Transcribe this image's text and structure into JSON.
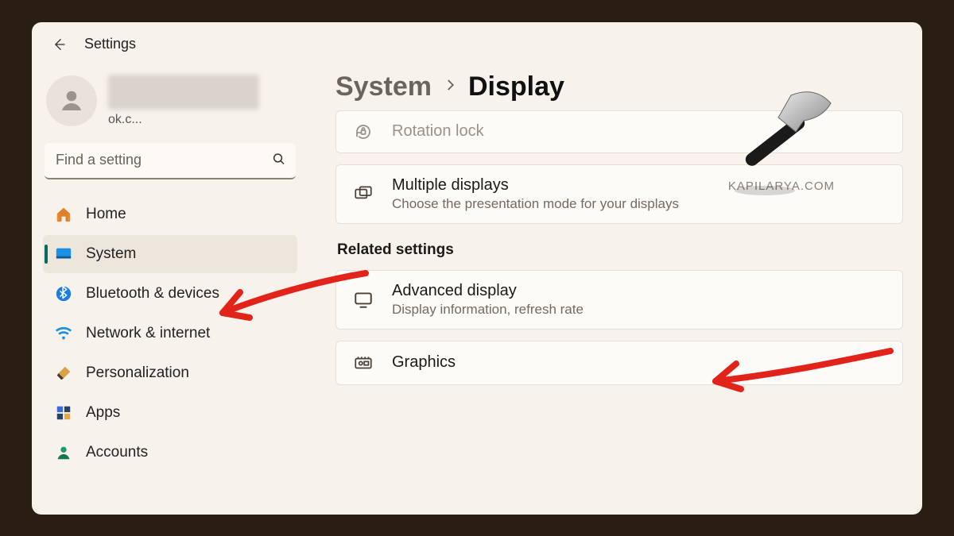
{
  "window": {
    "title": "Settings"
  },
  "profile": {
    "email_tail": "ok.c..."
  },
  "search": {
    "placeholder": "Find a setting"
  },
  "sidebar": {
    "items": [
      {
        "id": "home",
        "label": "Home"
      },
      {
        "id": "system",
        "label": "System",
        "active": true
      },
      {
        "id": "bluetooth",
        "label": "Bluetooth & devices"
      },
      {
        "id": "network",
        "label": "Network & internet"
      },
      {
        "id": "personalization",
        "label": "Personalization"
      },
      {
        "id": "apps",
        "label": "Apps"
      },
      {
        "id": "accounts",
        "label": "Accounts"
      }
    ]
  },
  "breadcrumb": {
    "parent": "System",
    "current": "Display"
  },
  "settings": {
    "rotation_lock": {
      "title": "Rotation lock"
    },
    "multiple_displays": {
      "title": "Multiple displays",
      "subtitle": "Choose the presentation mode for your displays"
    },
    "related_label": "Related settings",
    "advanced_display": {
      "title": "Advanced display",
      "subtitle": "Display information, refresh rate"
    },
    "graphics": {
      "title": "Graphics"
    }
  },
  "watermark": "KAPILARYA.COM"
}
